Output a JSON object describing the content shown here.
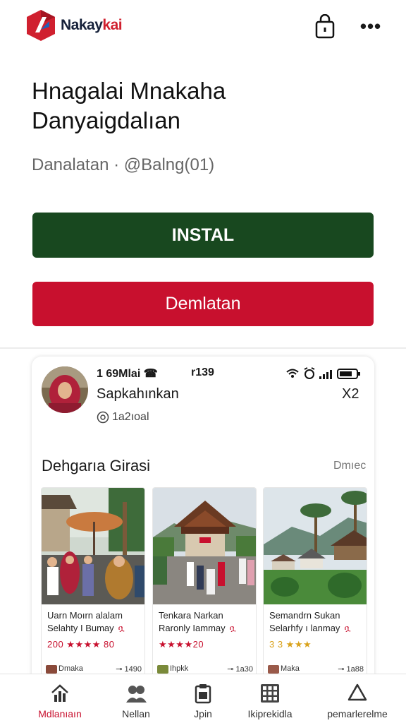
{
  "header": {
    "logo_text_main": "Nakay",
    "logo_text_accent": "kai",
    "lock_icon": "lock-icon",
    "more_icon": "more-dots-icon",
    "more_glyph": "•••"
  },
  "app": {
    "title": "Hnagalai Mnakaha Danyaigdalıan",
    "meta": "Danalatan · @Balng(01)"
  },
  "buttons": {
    "install": "INSTAL",
    "secondary": "Demlatan"
  },
  "colors": {
    "install_bg": "#18481f",
    "secondary_bg": "#c8102e",
    "accent": "#c8102e"
  },
  "card": {
    "status_time": "1 69Mlai ☎",
    "status_mid": "r139",
    "profile_name": "Sapkahınkan",
    "close_label": "X2",
    "handle": "1a2ıoal",
    "section_title": "Dehgarıa Girasi",
    "section_more": "Dmıec",
    "tiles": [
      {
        "caption1": "Uarn Moırn alalam",
        "caption2": "Selahty I Bumay",
        "flag": "ቧ",
        "rating": "200 ★★★★ 80",
        "footer_left": "Dmaka",
        "footer_right": "⊸ 1490"
      },
      {
        "caption1": "Tenkara Narkan",
        "caption2": "Raronly Iammay",
        "flag": "ቧ",
        "rating": "★★★★20",
        "footer_left": "Ihpkk",
        "footer_right": "⊸ 1a30"
      },
      {
        "caption1": "Semandrn Sukan",
        "caption2": "Selarhfy ı lanmay",
        "flag": "ቧ",
        "rating": "3 3 ★★★",
        "footer_left": "Maka",
        "footer_right": "⊸ 1a88"
      }
    ]
  },
  "bottom_nav": [
    {
      "label": "Mdlanıaın",
      "icon": "home-chart-icon"
    },
    {
      "label": "Nellan",
      "icon": "people-icon"
    },
    {
      "label": "Jpin",
      "icon": "clipboard-icon"
    },
    {
      "label": "Ikiprekidla",
      "icon": "grid-icon"
    },
    {
      "label": "pemarlerelme",
      "icon": "recycle-icon"
    }
  ]
}
